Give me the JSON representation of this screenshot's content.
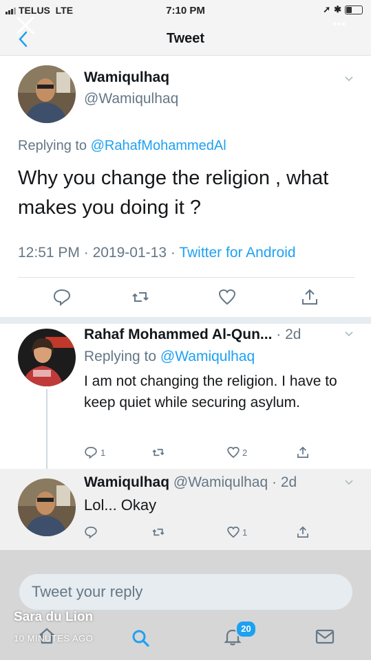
{
  "status_bar": {
    "carrier": "TELUS",
    "network": "LTE",
    "time": "7:10 PM"
  },
  "header": {
    "title": "Tweet"
  },
  "tweet": {
    "name": "Wamiqulhaq",
    "handle": "@Wamiqulhaq",
    "replying_prefix": "Replying to",
    "replying_to": "@RahafMohammedAl",
    "text": "Why you change the religion , what makes you doing it ?",
    "time": "12:51 PM",
    "date": "2019-01-13",
    "source": "Twitter for Android",
    "dot": "·"
  },
  "replies": [
    {
      "name": "Rahaf Mohammed Al-Qun...",
      "age": "2d",
      "replying_prefix": "Replying to",
      "replying_to": "@Wamiqulhaq",
      "text": "I am not changing the religion. I have to keep quiet while securing asylum.",
      "reply_count": "1",
      "like_count": "2"
    },
    {
      "name": "Wamiqulhaq",
      "handle": "@Wamiqulhaq",
      "age": "2d",
      "text": "Lol... Okay",
      "like_count": "1"
    }
  ],
  "reply_input": {
    "placeholder": "Tweet your reply"
  },
  "bottom_nav": {
    "notification_count": "20"
  },
  "overlay": {
    "name": "Sara  du Lion",
    "time": "10 MINUTES AGO"
  },
  "colors": {
    "accent": "#1da1f2",
    "secondary_text": "#657786"
  }
}
